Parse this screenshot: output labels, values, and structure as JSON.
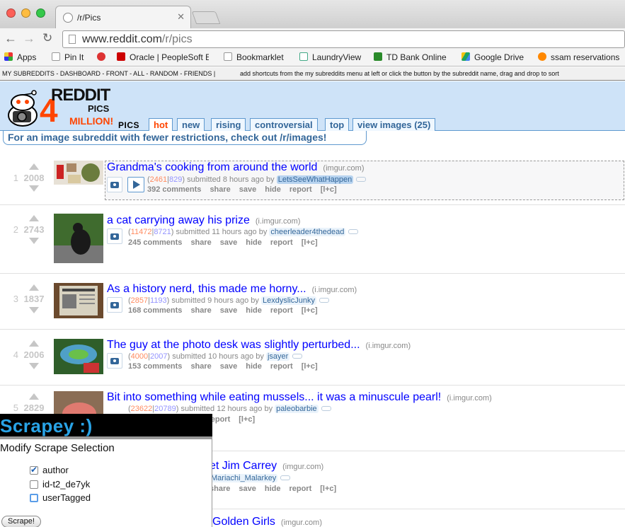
{
  "browser": {
    "tab_title": "/r/Pics",
    "url_domain": "www.reddit.com",
    "url_path": "/r/pics",
    "bookmarks": [
      "Apps",
      "Pin It",
      "Oracle | PeopleSoft E",
      "Bookmarklet",
      "LaundryView",
      "TD Bank Online",
      "Google Drive",
      "ssam reservations"
    ]
  },
  "reddit": {
    "subreddit_bar": "MY SUBREDDITS - DASHBOARD - FRONT - ALL - RANDOM - FRIENDS  |",
    "subreddit_bar_hint": "add shortcuts from the my subreddits menu at left or click the button by the subreddit name, drag and drop to sort",
    "logo": {
      "word": "REDDIT",
      "pics": "PICS",
      "four": "4",
      "million": "MILLION!"
    },
    "subreddit_name": "PICS",
    "tabs": [
      "hot",
      "new",
      "rising",
      "controversial",
      "top",
      "view images (25)"
    ],
    "selected_tab": "hot",
    "notice": "For an image subreddit with fewer restrictions, check out /r/images!",
    "posts": [
      {
        "rank": "1",
        "score": "2008",
        "title": "Grandma's cooking from around the world",
        "domain": "(imgur.com)",
        "ups": "2461",
        "downs": "829",
        "time": "submitted 8 hours ago by",
        "author": "LetsSeeWhatHappen",
        "comments": "392 comments"
      },
      {
        "rank": "2",
        "score": "2743",
        "title": "a cat carrying away his prize",
        "domain": "(i.imgur.com)",
        "ups": "11472",
        "downs": "8721",
        "time": "submitted 11 hours ago by",
        "author": "cheerleader4thedead",
        "comments": "245 comments"
      },
      {
        "rank": "3",
        "score": "1837",
        "title": "As a history nerd, this made me horny...",
        "domain": "(i.imgur.com)",
        "ups": "2857",
        "downs": "1193",
        "time": "submitted 9 hours ago by",
        "author": "LexdyslicJunky",
        "comments": "168 comments"
      },
      {
        "rank": "4",
        "score": "2006",
        "title": "The guy at the photo desk was slightly perturbed...",
        "domain": "(i.imgur.com)",
        "ups": "4000",
        "downs": "2007",
        "time": "submitted 10 hours ago by",
        "author": "jsayer",
        "comments": "153 comments"
      },
      {
        "rank": "5",
        "score": "2829",
        "title": "Bit into something while eating mussels... it was a minuscule pearl!",
        "domain": "(i.imgur.com)",
        "ups": "23622",
        "downs": "20789",
        "time": "submitted 12 hours ago by",
        "author": "paleobarbie"
      },
      {
        "title": "et Jim Carrey",
        "domain": "(imgur.com)",
        "author": "Mariachi_Malarkey"
      },
      {
        "title": "Golden Girls",
        "domain": "(imgur.com)"
      }
    ],
    "actions": {
      "share": "share",
      "save": "save",
      "hide": "hide",
      "report": "report",
      "lc": "[l+c]"
    }
  },
  "scrapey": {
    "title": "Scrapey :)",
    "subtitle": "Modify Scrape Selection",
    "options": [
      {
        "label": "author",
        "checked": true
      },
      {
        "label": "id-t2_de7yk",
        "checked": false
      },
      {
        "label": "userTagged",
        "checked": false
      }
    ],
    "button": "Scrape!"
  },
  "colors": {
    "reddit_blue": "#cee3f8",
    "link_blue": "#0000ff",
    "orangered": "#ff4500",
    "scrapey_blue": "#29a3e6"
  }
}
